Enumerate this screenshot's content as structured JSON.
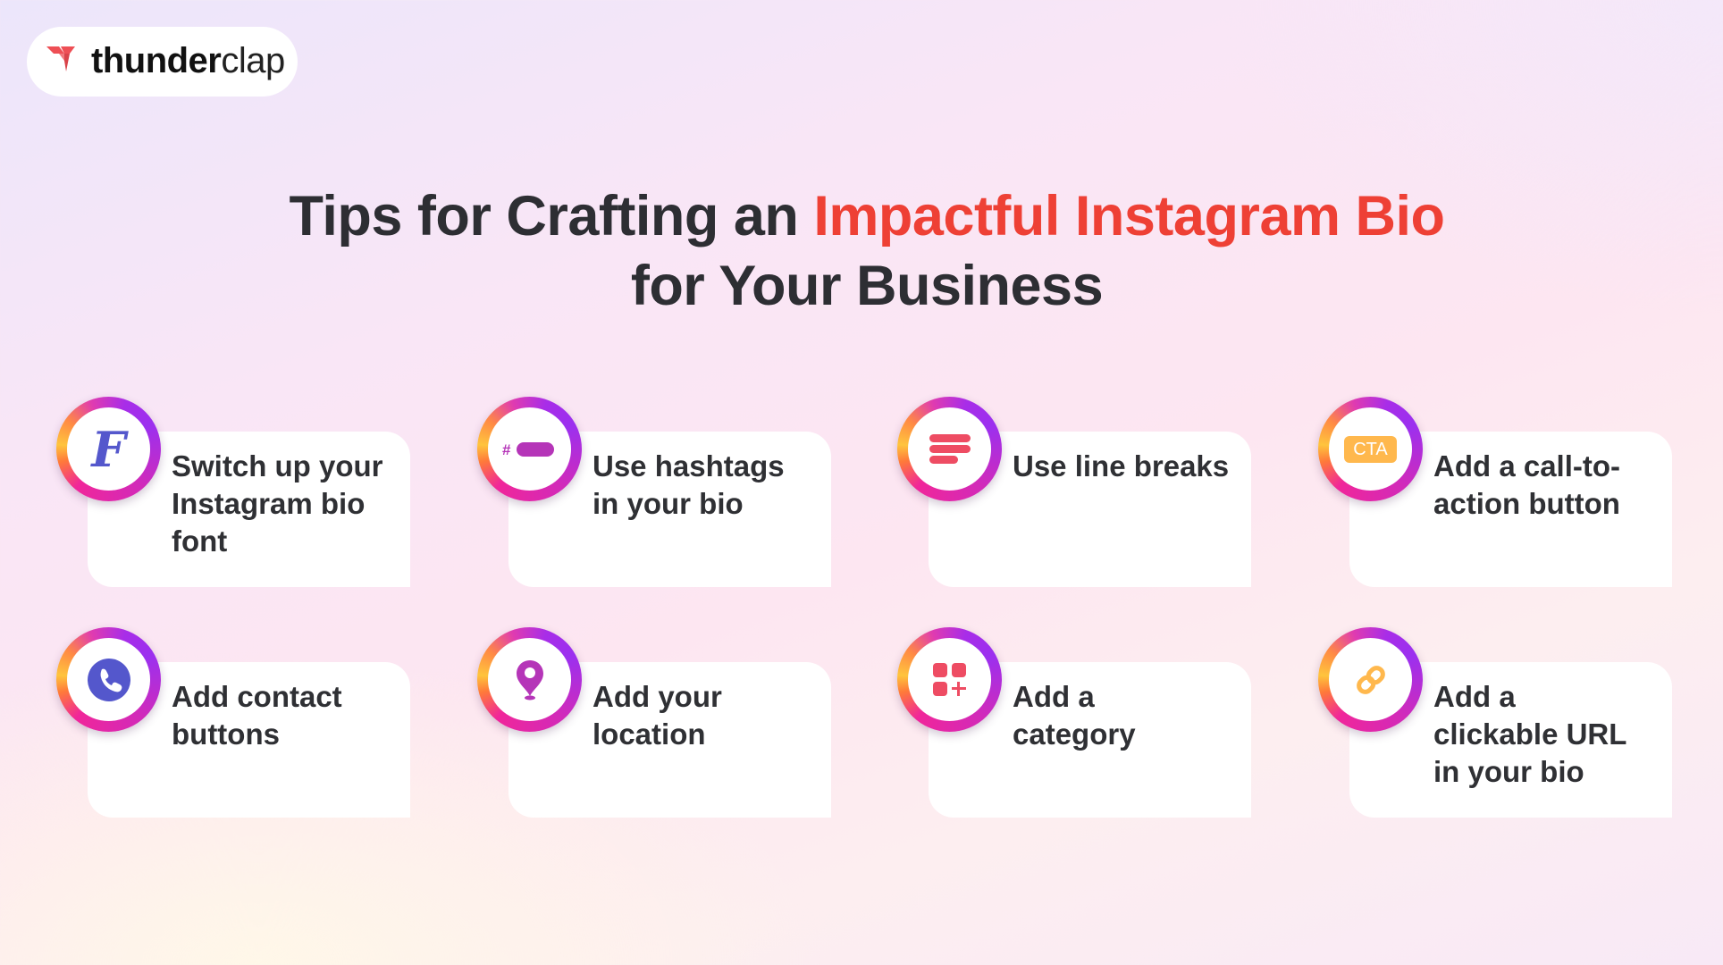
{
  "brand": {
    "name_bold": "thunder",
    "name_light": "clap",
    "logo_icon": "thunderclap-logo-icon",
    "logo_color": "#ee4f55"
  },
  "title": {
    "line1_prefix": "Tips for Crafting an ",
    "line1_accent": "Impactful Instagram Bio",
    "line2": "for Your Business",
    "text_color": "#2d2e33",
    "accent_color": "#ee4035"
  },
  "tips": [
    {
      "label": "Switch up your Instagram bio font",
      "icon": "font-icon"
    },
    {
      "label": "Use hashtags in your bio",
      "icon": "hashtag-icon"
    },
    {
      "label": "Use line breaks",
      "icon": "line-breaks-icon"
    },
    {
      "label": "Add a call-to-action button",
      "icon": "cta-icon",
      "icon_text": "CTA"
    },
    {
      "label": "Add contact buttons",
      "icon": "phone-icon"
    },
    {
      "label": "Add your location",
      "icon": "location-pin-icon"
    },
    {
      "label": "Add a category",
      "icon": "category-grid-icon"
    },
    {
      "label": "Add a clickable URL in your bio",
      "icon": "link-icon"
    }
  ],
  "icon_glyphs": {
    "font": "F",
    "hashtag": "#"
  }
}
